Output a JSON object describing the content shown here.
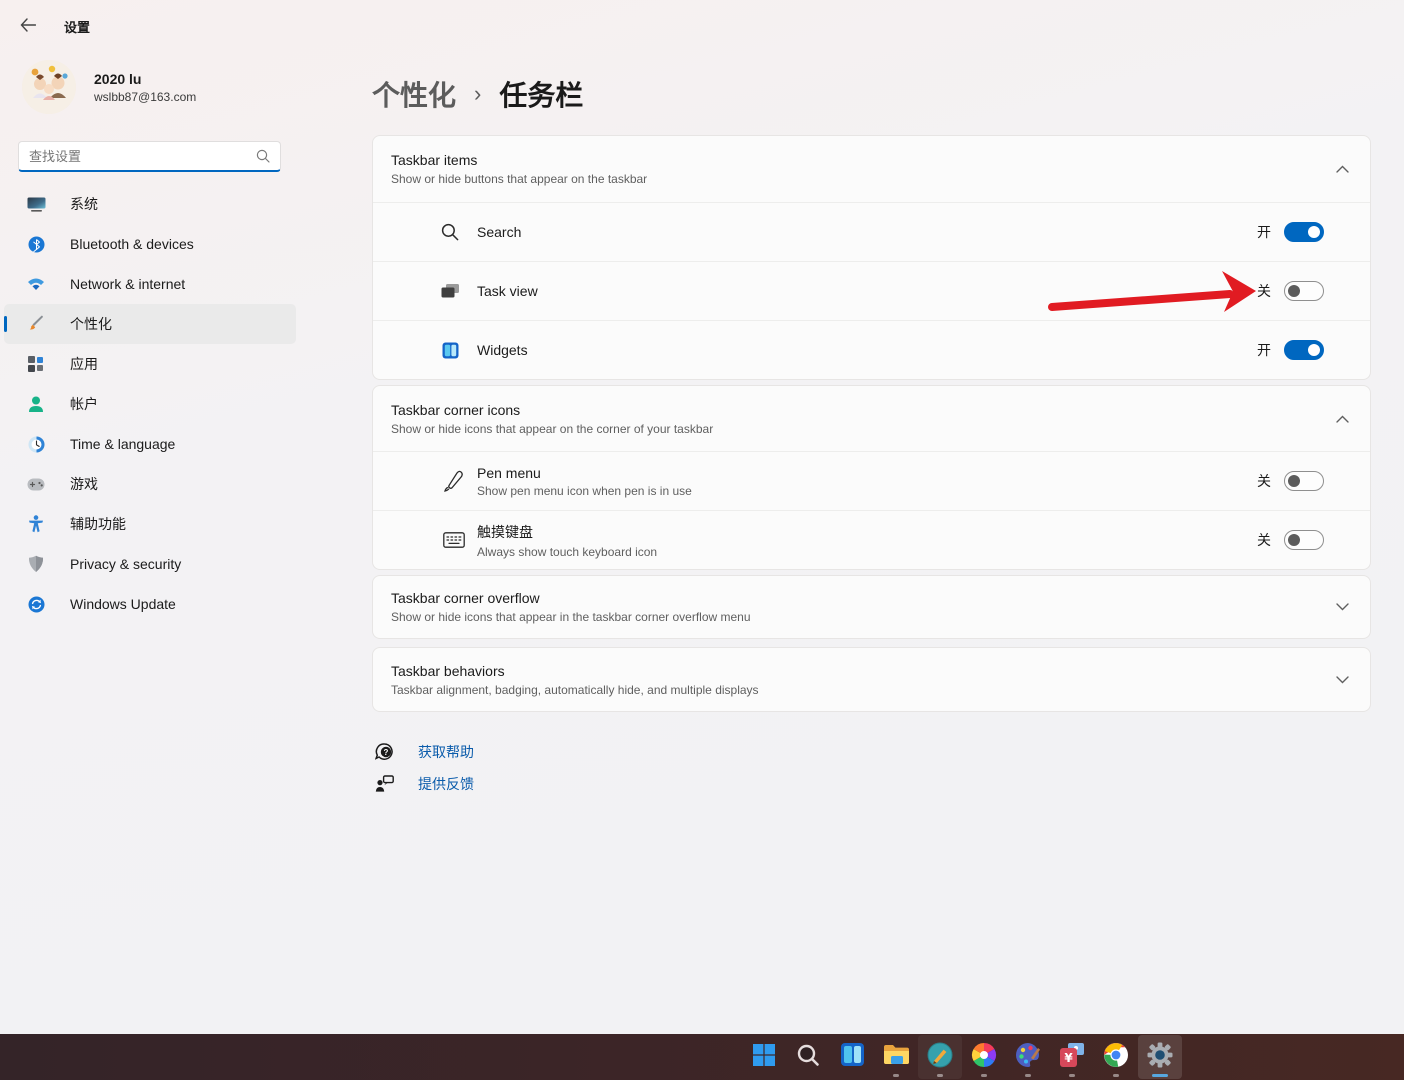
{
  "titlebar": {
    "app_title": "设置"
  },
  "user": {
    "name": "2020 lu",
    "email": "wslbb87@163.com"
  },
  "sidebar": {
    "search_placeholder": "查找设置",
    "selected_index": 3,
    "items": [
      {
        "label": "系统",
        "icon": "system-icon"
      },
      {
        "label": "Bluetooth & devices",
        "icon": "bluetooth-icon"
      },
      {
        "label": "Network & internet",
        "icon": "network-icon"
      },
      {
        "label": "个性化",
        "icon": "personalization-icon"
      },
      {
        "label": "应用",
        "icon": "apps-icon"
      },
      {
        "label": "帐户",
        "icon": "accounts-icon"
      },
      {
        "label": "Time & language",
        "icon": "time-language-icon"
      },
      {
        "label": "游戏",
        "icon": "gaming-icon"
      },
      {
        "label": "辅助功能",
        "icon": "accessibility-icon"
      },
      {
        "label": "Privacy & security",
        "icon": "privacy-icon"
      },
      {
        "label": "Windows Update",
        "icon": "windows-update-icon"
      }
    ]
  },
  "breadcrumb": {
    "parent": "个性化",
    "separator": "›",
    "current": "任务栏"
  },
  "sections": [
    {
      "title": "Taskbar items",
      "subtitle": "Show or hide buttons that appear on the taskbar",
      "expanded": true,
      "rows": [
        {
          "label": "Search",
          "icon": "search-icon",
          "state": "开",
          "on": true
        },
        {
          "label": "Task view",
          "icon": "task-view-icon",
          "state": "关",
          "on": false
        },
        {
          "label": "Widgets",
          "icon": "widgets-icon",
          "state": "开",
          "on": true
        }
      ]
    },
    {
      "title": "Taskbar corner icons",
      "subtitle": "Show or hide icons that appear on the corner of your taskbar",
      "expanded": true,
      "rows": [
        {
          "label": "Pen menu",
          "description": "Show pen menu icon when pen is in use",
          "icon": "pen-icon",
          "state": "关",
          "on": false
        },
        {
          "label": "触摸键盘",
          "description": "Always show touch keyboard icon",
          "icon": "touch-keyboard-icon",
          "state": "关",
          "on": false
        }
      ]
    },
    {
      "title": "Taskbar corner overflow",
      "subtitle": "Show or hide icons that appear in the taskbar corner overflow menu",
      "expanded": false
    },
    {
      "title": "Taskbar behaviors",
      "subtitle": "Taskbar alignment, badging, automatically hide, and multiple displays",
      "expanded": false
    }
  ],
  "help": {
    "links": [
      {
        "label": "获取帮助",
        "icon": "get-help-icon"
      },
      {
        "label": "提供反馈",
        "icon": "feedback-icon"
      }
    ]
  },
  "taskbar": {
    "buttons": [
      "start",
      "taskbar-search",
      "widgets",
      "file-explorer",
      "pencil-app",
      "color-wheel-app",
      "palette-app",
      "yen-pay-app",
      "chrome",
      "settings"
    ],
    "active": "settings"
  },
  "colors": {
    "accent": "#0067c0",
    "link": "#0b5cab",
    "taskbar_background": "#3b2628",
    "arrow": "#e11b22"
  }
}
